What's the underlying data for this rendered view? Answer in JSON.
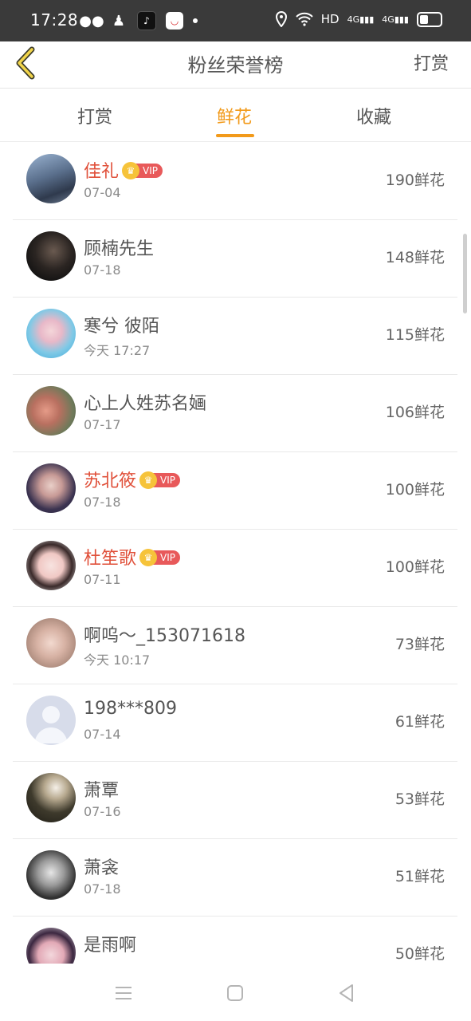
{
  "status_bar": {
    "time": "17:28",
    "network": "HD",
    "signal1": "4G",
    "signal2": "4G"
  },
  "header": {
    "title": "粉丝荣誉榜",
    "action": "打赏"
  },
  "tabs": [
    {
      "label": "打赏",
      "active": false
    },
    {
      "label": "鲜花",
      "active": true
    },
    {
      "label": "收藏",
      "active": false
    }
  ],
  "vip_label": "VIP",
  "accent_color": "#f29a1a",
  "vip_name_color": "#e0503a",
  "fans": [
    {
      "name": "佳礼",
      "date": "07-04",
      "amount": "190鲜花",
      "vip": true
    },
    {
      "name": "顾楠先生",
      "date": "07-18",
      "amount": "148鲜花",
      "vip": false
    },
    {
      "name": "寒兮 彼陌",
      "date": "今天 17:27",
      "amount": "115鲜花",
      "vip": false
    },
    {
      "name": "心上人姓苏名婳",
      "date": "07-17",
      "amount": "106鲜花",
      "vip": false
    },
    {
      "name": "苏北筱",
      "date": "07-18",
      "amount": "100鲜花",
      "vip": true
    },
    {
      "name": "杜笙歌",
      "date": "07-11",
      "amount": "100鲜花",
      "vip": true
    },
    {
      "name": "啊呜～_153071618",
      "date": "今天 10:17",
      "amount": "73鲜花",
      "vip": false
    },
    {
      "name": "198***809",
      "date": "07-14",
      "amount": "61鲜花",
      "vip": false
    },
    {
      "name": "萧覃",
      "date": "07-16",
      "amount": "53鲜花",
      "vip": false
    },
    {
      "name": "萧衾",
      "date": "07-18",
      "amount": "51鲜花",
      "vip": false
    },
    {
      "name": "是雨啊",
      "date": "",
      "amount": "50鲜花",
      "vip": false
    }
  ]
}
